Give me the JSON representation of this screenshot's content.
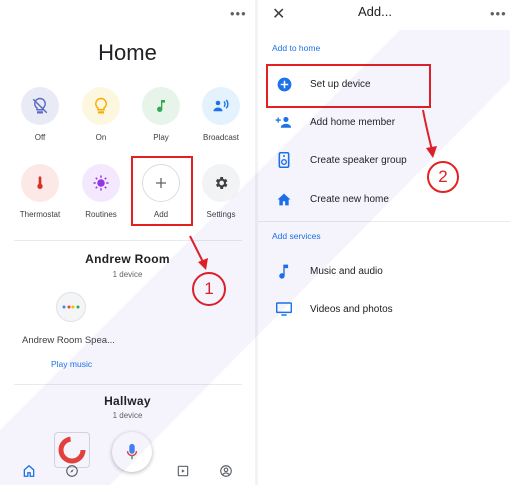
{
  "home": {
    "title": "Home",
    "menu_dots": "•••",
    "tiles_row1": [
      {
        "label": "Off",
        "icon": "bulb-off-icon",
        "bg": "#e8eaf6"
      },
      {
        "label": "On",
        "icon": "bulb-on-icon",
        "bg": "#fef7e0"
      },
      {
        "label": "Play",
        "icon": "music-note-icon",
        "bg": "#e6f4ea"
      },
      {
        "label": "Broadcast",
        "icon": "broadcast-icon",
        "bg": "#e3f2fd"
      }
    ],
    "tiles_row2": [
      {
        "label": "Thermostat",
        "icon": "thermometer-icon",
        "bg": "#fce8e6"
      },
      {
        "label": "Routines",
        "icon": "routines-icon",
        "bg": "#f3e8fd"
      },
      {
        "label": "Add",
        "icon": "plus-icon",
        "bg": "#ffffff"
      },
      {
        "label": "Settings",
        "icon": "gear-icon",
        "bg": "#f1f3f4"
      }
    ],
    "rooms": [
      {
        "name": "Andrew Room",
        "count": "1 device"
      },
      {
        "name": "Hallway",
        "count": "1 device"
      }
    ],
    "speaker_name": "Andrew Room Spea...",
    "play_music": "Play music",
    "callout_1": "1"
  },
  "add": {
    "title": "Add...",
    "menu_dots": "•••",
    "close": "✕",
    "section_home": "Add to home",
    "home_items": [
      {
        "label": "Set up device",
        "icon": "plus-circle-icon"
      },
      {
        "label": "Add home member",
        "icon": "add-person-icon"
      },
      {
        "label": "Create speaker group",
        "icon": "speaker-group-icon"
      },
      {
        "label": "Create new home",
        "icon": "house-icon"
      }
    ],
    "section_services": "Add services",
    "service_items": [
      {
        "label": "Music and audio",
        "icon": "music-note-icon"
      },
      {
        "label": "Videos and photos",
        "icon": "monitor-icon"
      }
    ],
    "callout_2": "2"
  },
  "colors": {
    "accent": "#1a73e8",
    "highlight": "#e52020"
  }
}
